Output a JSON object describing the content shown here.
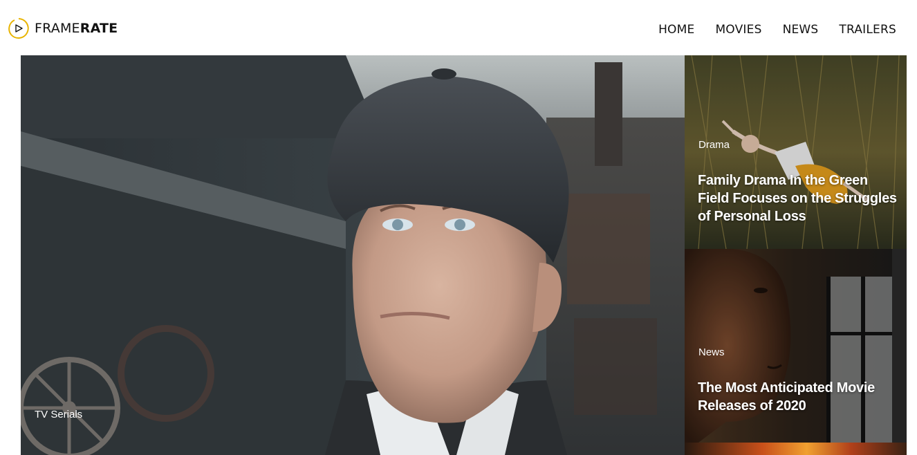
{
  "header": {
    "logo_part1": "FRAME",
    "logo_part2": "RATE",
    "nav": [
      "HOME",
      "MOVIES",
      "NEWS",
      "TRAILERS"
    ]
  },
  "hero": {
    "category": "TV Serials"
  },
  "cards": [
    {
      "category": "Drama",
      "title": "Family Drama In the Green Field Focuses on the Struggles of Personal Loss"
    },
    {
      "category": "News",
      "title": "The Most Anticipated Movie Releases of 2020"
    }
  ],
  "colors": {
    "accent": "#e8b400",
    "text": "#111111",
    "overlay_text": "#ffffff"
  },
  "icons": [
    "play-circle-icon"
  ]
}
